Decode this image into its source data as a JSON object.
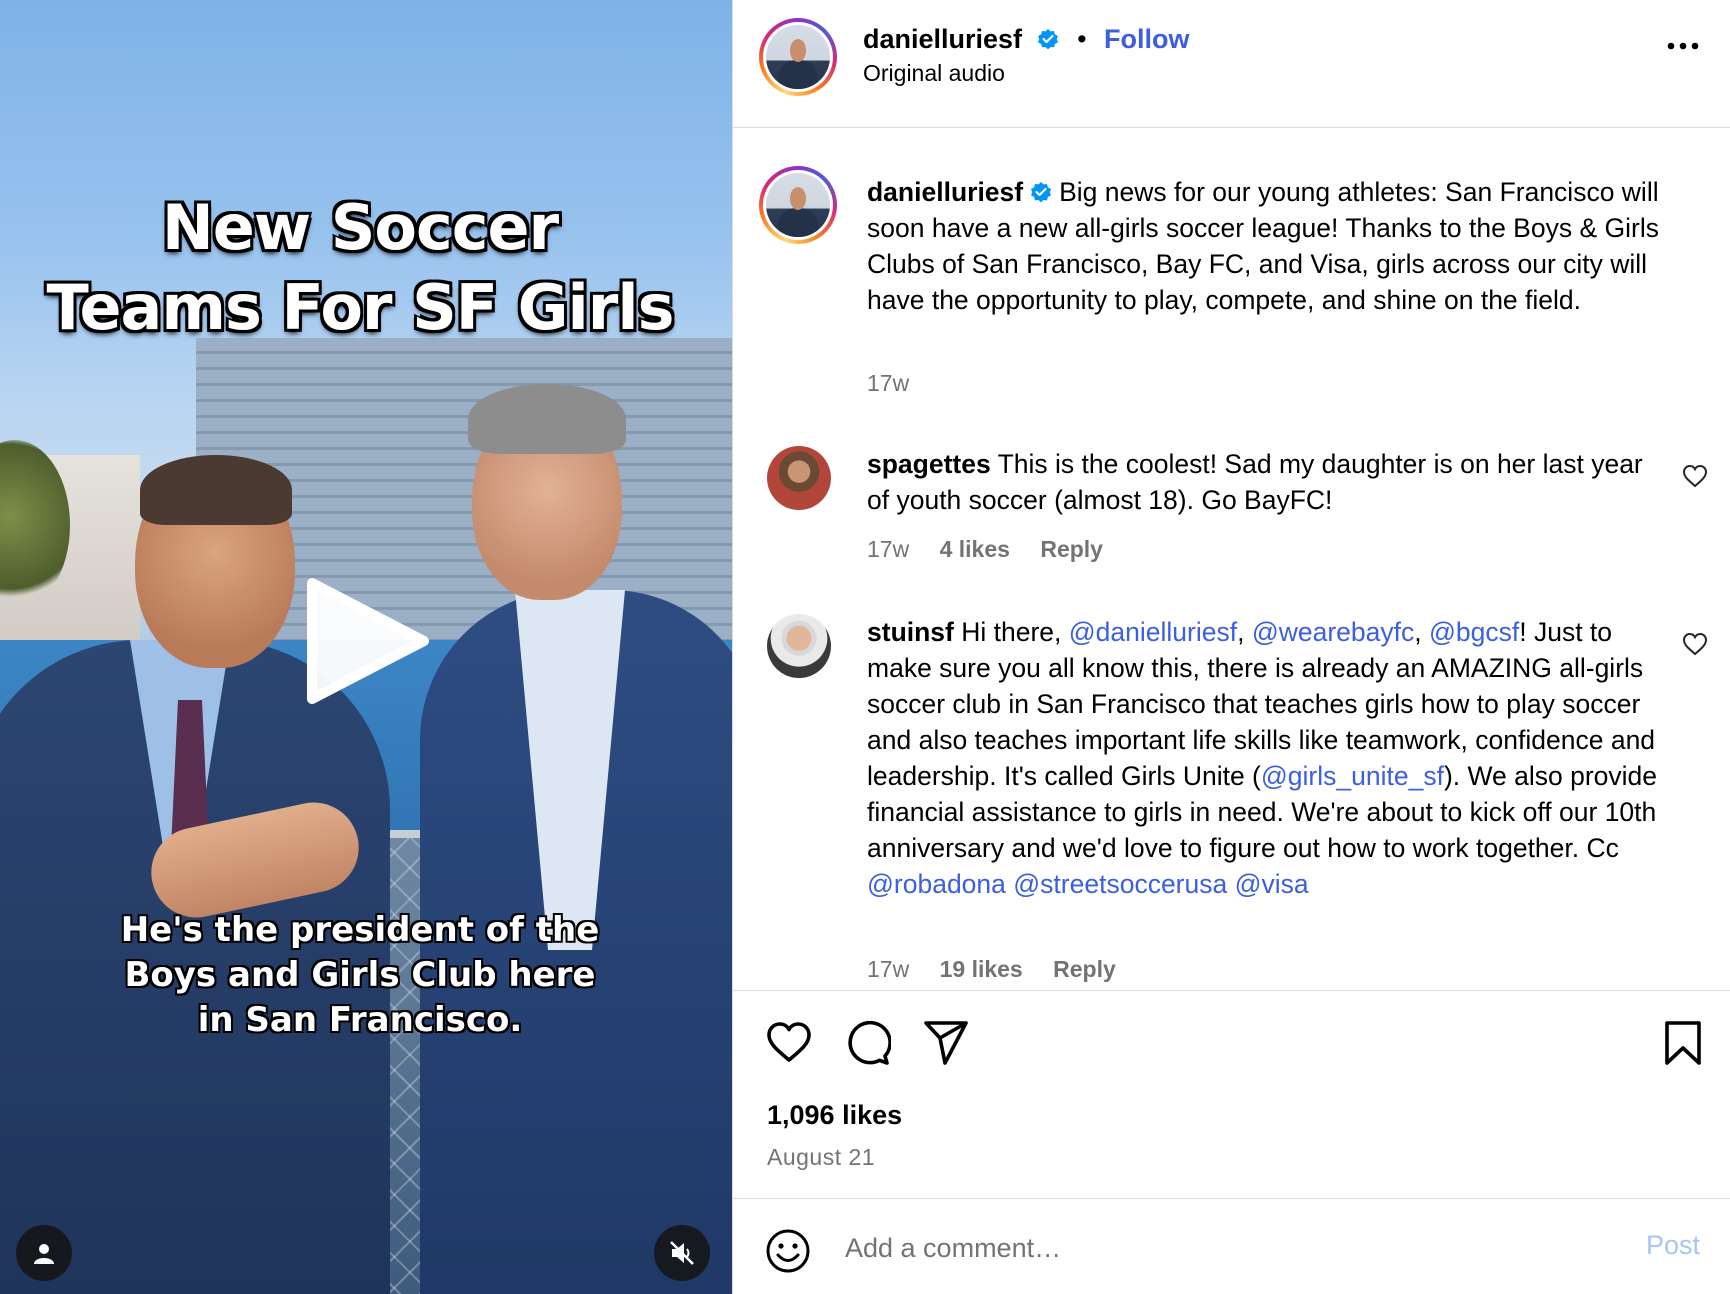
{
  "video": {
    "title_line1": "New Soccer",
    "title_line2": "Teams For SF Girls",
    "caption_line1": "He's the president of the",
    "caption_line2": "Boys and Girls Club here",
    "caption_line3": "in San Francisco.",
    "play_icon": "play-icon",
    "user_icon": "user-icon",
    "mute_icon": "muted-speaker-icon"
  },
  "header": {
    "username": "danielluriesf",
    "separator": "•",
    "follow_label": "Follow",
    "audio_label": "Original audio"
  },
  "caption": {
    "username": "danielluriesf",
    "text": "Big news for our young athletes: San Francisco will soon have a new all-girls soccer league! Thanks to the Boys & Girls Clubs of San Francisco, Bay FC, and Visa, girls across our city will have the opportunity to play, compete, and shine on the field.",
    "time": "17w"
  },
  "comments": [
    {
      "username": "spagettes",
      "text": "This is the coolest! Sad my daughter is on her last year of youth soccer (almost 18). Go BayFC!",
      "time": "17w",
      "likes": "4 likes",
      "reply": "Reply"
    },
    {
      "username": "stuinsf",
      "text_1": "Hi there, ",
      "mention_1": "@danielluriesf",
      "text_2": ", ",
      "mention_2": "@wearebayfc",
      "text_3": ", ",
      "mention_3": "@bgcsf",
      "text_4": "! Just to make sure you all know this, there is already an AMAZING all-girls soccer club in San Francisco that teaches girls how to play soccer and also teaches important life skills like teamwork, confidence and leadership. It's called Girls Unite (",
      "mention_4": "@girls_unite_sf",
      "text_5": "). We also provide financial assistance to girls in need. We're about to kick off our 10th anniversary and we'd love to figure out how to work together. Cc ",
      "mention_5": "@robadona",
      "mention_6": "@streetsoccerusa",
      "mention_7": "@visa",
      "time": "17w",
      "likes": "19 likes",
      "reply": "Reply"
    }
  ],
  "actions": {
    "like_icon": "heart-icon",
    "comment_icon": "comment-icon",
    "share_icon": "share-icon",
    "save_icon": "bookmark-icon"
  },
  "stats": {
    "likes": "1,096 likes",
    "date": "August 21"
  },
  "add_comment": {
    "placeholder": "Add a comment…",
    "post_label": "Post"
  },
  "colors": {
    "link": "#3b5fe0",
    "muted": "#737373",
    "post_disabled": "#a7c4f5",
    "verified": "#0095f6"
  }
}
